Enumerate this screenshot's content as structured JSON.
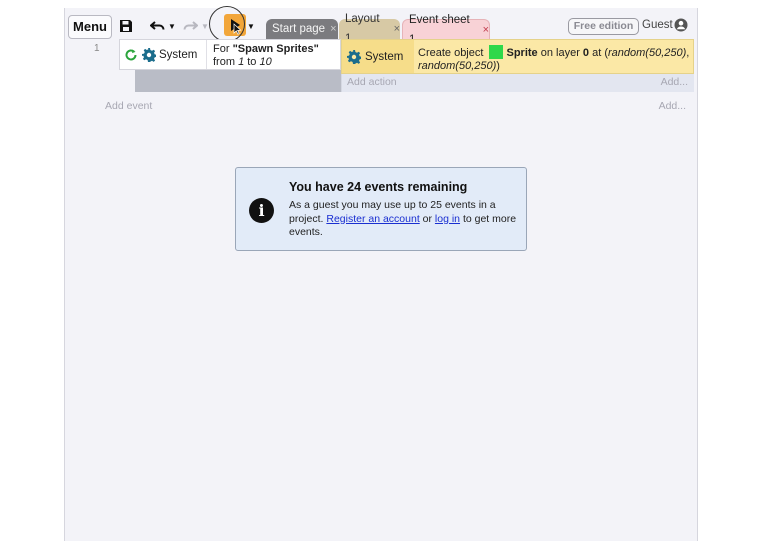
{
  "toolbar": {
    "menu_label": "Menu",
    "save_icon": "floppy-disk-icon",
    "undo_icon": "undo-icon",
    "redo_icon": "redo-icon",
    "play_icon": "play-icon"
  },
  "tabs": [
    {
      "label": "Start page",
      "close": "×"
    },
    {
      "label": "Layout 1",
      "close": "×"
    },
    {
      "label": "Event sheet 1",
      "close": "×"
    }
  ],
  "account": {
    "edition_badge": "Free edition",
    "user_label": "Guest"
  },
  "event_sheet": {
    "row_number": "1",
    "condition": {
      "object": "System",
      "text_prefix": "For ",
      "loop_name": "\"Spawn Sprites\"",
      "from_word": "from ",
      "from_value": "1",
      "to_word": " to ",
      "to_value": "10"
    },
    "action": {
      "object": "System",
      "text_create": "Create object ",
      "sprite_name": "Sprite",
      "text_on_layer": " on layer ",
      "layer_value": "0",
      "text_at": " at (",
      "x_expr": "random(50,250)",
      "comma": ",",
      "y_expr": "random(50,250)",
      "close_paren": ")"
    },
    "add_action_label": "Add action",
    "add_right_label": "Add...",
    "add_event_label": "Add event",
    "add_event_right_label": "Add..."
  },
  "notice": {
    "icon": "info-icon",
    "title": "You have 24 events remaining",
    "body_prefix": "As a guest you may use up to 25 events in a project. ",
    "register_link": "Register an account",
    "or_text": " or ",
    "login_link": "log in",
    "body_suffix": " to get more events."
  },
  "colors": {
    "accent_play": "#f2a63a",
    "action_bg": "#fbe8a6",
    "notice_bg": "#e2ebf8",
    "link": "#1a2fd1",
    "sprite_swatch": "#2fd84a"
  }
}
